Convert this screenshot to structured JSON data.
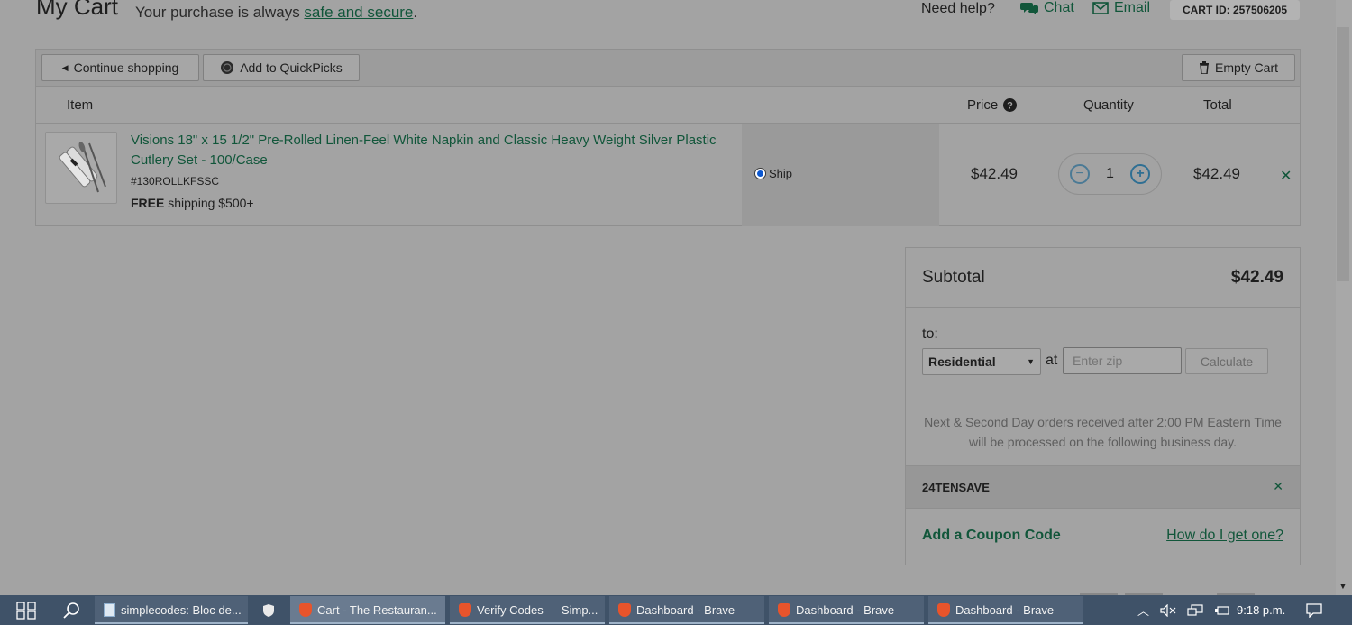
{
  "header": {
    "title": "My Cart",
    "tagline_prefix": "Your purchase is always ",
    "tagline_link": "safe and secure",
    "tagline_suffix": ".",
    "need_help": "Need help?",
    "chat": "Chat",
    "email": "Email",
    "cart_id": "CART ID: 257506205"
  },
  "toolbar": {
    "continue_label": "Continue shopping",
    "quickpicks_label": "Add to QuickPicks",
    "empty_label": "Empty Cart"
  },
  "table": {
    "headers": {
      "item": "Item",
      "price": "Price",
      "quantity": "Quantity",
      "total": "Total"
    },
    "rows": [
      {
        "name": "Visions 18\" x 15 1/2\" Pre-Rolled Linen-Feel White Napkin and Classic Heavy Weight Silver Plastic Cutlery Set - 100/Case",
        "sku": "#130ROLLKFSSC",
        "shipping_bold": "FREE",
        "shipping_rest": " shipping $500+",
        "ship_option": "Ship",
        "price": "$42.49",
        "quantity": "1",
        "total": "$42.49"
      }
    ]
  },
  "summary": {
    "subtotal_label": "Subtotal",
    "subtotal_value": "$42.49",
    "to_label": "to:",
    "address_type": "Residential",
    "at_label": "at",
    "zip_placeholder": "Enter zip",
    "calculate_label": "Calculate",
    "notice": "Next & Second Day orders received after 2:00 PM Eastern Time will be processed on the following business day.",
    "coupon_code": "24TENSAVE",
    "add_coupon": "Add a Coupon Code",
    "how_link": "How do I get one?"
  },
  "taskbar": {
    "tasks": [
      {
        "label": "simplecodes: Bloc de..."
      },
      {
        "label": "Cart - The Restauran..."
      },
      {
        "label": "Verify Codes — Simp..."
      },
      {
        "label": "Dashboard - Brave"
      },
      {
        "label": "Dashboard - Brave"
      },
      {
        "label": "Dashboard - Brave"
      }
    ],
    "clock": "9:18 p.m."
  },
  "colors": {
    "link_green": "#11563a",
    "qty_blue": "#2f6f93",
    "taskbar": "#3f5268"
  }
}
